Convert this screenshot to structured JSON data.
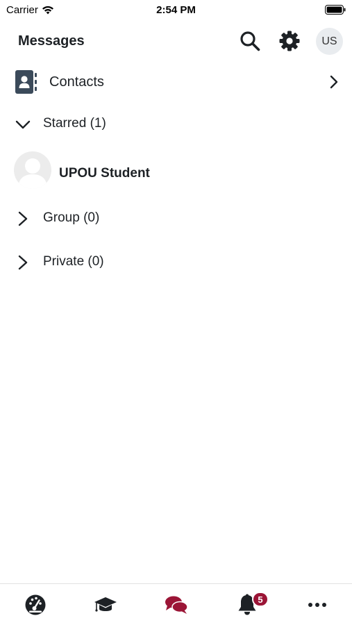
{
  "status_bar": {
    "carrier": "Carrier",
    "time": "2:54 PM"
  },
  "header": {
    "title": "Messages",
    "search_icon": "search-icon",
    "settings_icon": "gear-icon",
    "user_initials": "US"
  },
  "contacts": {
    "label": "Contacts",
    "icon": "address-book-icon"
  },
  "sections": {
    "starred": {
      "label": "Starred (1)",
      "expanded": true
    },
    "group": {
      "label": "Group (0)",
      "expanded": false
    },
    "private": {
      "label": "Private (0)",
      "expanded": false
    }
  },
  "starred_conversations": [
    {
      "name": "UPOU Student",
      "avatar": "default-user-avatar"
    }
  ],
  "tab_bar": {
    "tabs": [
      {
        "name": "dashboard",
        "icon": "dashboard-gauge-icon"
      },
      {
        "name": "my-courses",
        "icon": "graduation-cap-icon"
      },
      {
        "name": "messages",
        "icon": "comments-icon",
        "active": true
      },
      {
        "name": "notifications",
        "icon": "bell-icon",
        "badge": "5"
      },
      {
        "name": "more",
        "icon": "more-dots-icon"
      }
    ]
  },
  "colors": {
    "accent": "#9b1536",
    "text": "#1d2125",
    "icon": "#1d2125",
    "avatar_bg": "#e9ecef"
  }
}
